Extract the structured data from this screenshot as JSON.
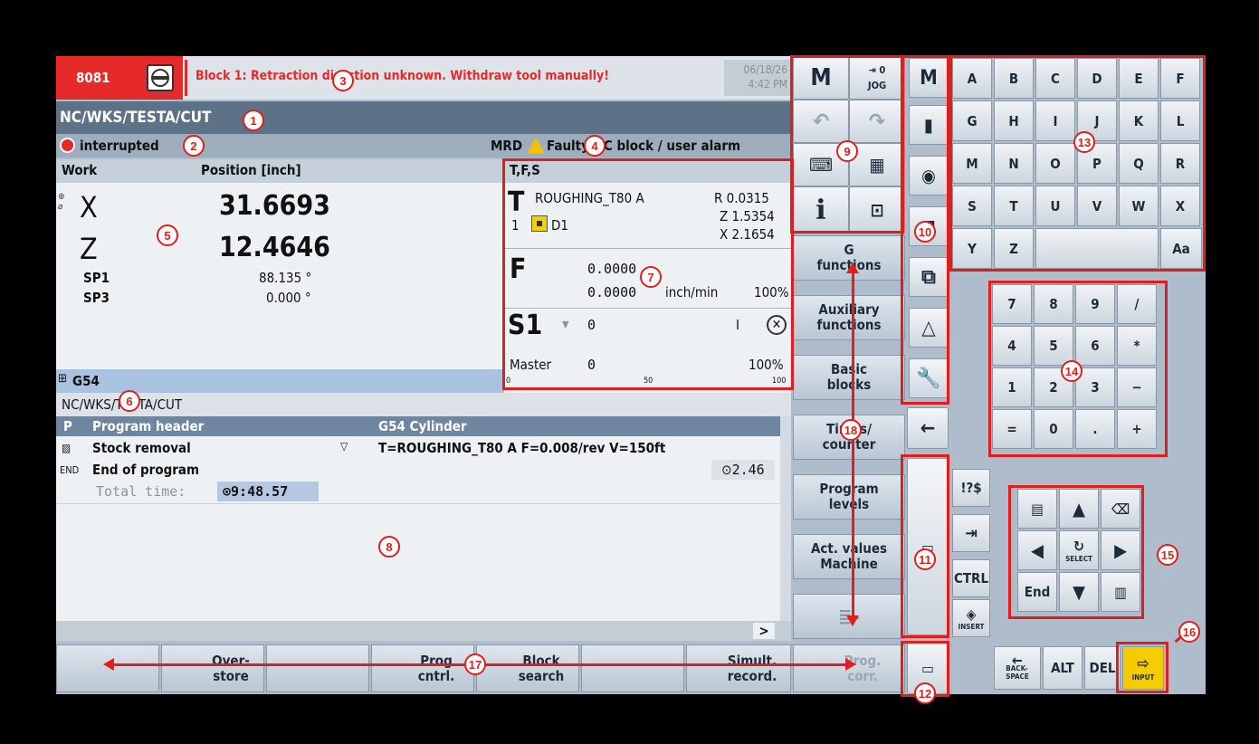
{
  "alarm": {
    "code": "8081",
    "message": "Block 1: Retraction direction unknown. Withdraw tool manually!",
    "date": "06/18/26",
    "time": "4:42 PM"
  },
  "path": "NC/WKS/TESTA/CUT",
  "status": {
    "state": "interrupted",
    "mode": "MRD",
    "warning": "Faulty NC block / user alarm"
  },
  "position": {
    "header_left": "Work",
    "header_right": "Position [inch]",
    "axes": [
      {
        "name": "X",
        "value": "31.6693"
      },
      {
        "name": "Z",
        "value": "12.4646"
      }
    ],
    "spindles": [
      {
        "name": "SP1",
        "value": "88.135 °"
      },
      {
        "name": "SP3",
        "value": "0.000 °"
      }
    ],
    "work_offset": "G54"
  },
  "tfs": {
    "title": "T,F,S",
    "tool": "ROUGHING_T80 A",
    "tool_num": "1",
    "edge": "D1",
    "r": "R 0.0315",
    "z": "Z 1.5354",
    "x": "X 2.1654",
    "feed1": "0.0000",
    "feed2": "0.0000",
    "feed_unit": "inch/min",
    "feed_pct": "100%",
    "spindle": "S1",
    "speed": "0",
    "spindle_dir": "I",
    "master_label": "Master",
    "master_val": "0",
    "master_pct": "100%",
    "scale": [
      "0",
      "50",
      "100"
    ]
  },
  "program": {
    "path": "NC/WKS/TESTA/CUT",
    "rows": [
      {
        "tag": "P",
        "name": "Program header",
        "param": "G54 Cylinder"
      },
      {
        "tag": "▨",
        "name": "Stock removal",
        "param": "T=ROUGHING_T80 A F=0.008/rev V=150ft"
      },
      {
        "tag": "END",
        "name": "End of program",
        "param": "2.46"
      }
    ],
    "total_label": "Total time:",
    "total_value": "9:48.57"
  },
  "softkeys_h": [
    "",
    "Over-\nstore",
    "",
    "Prog\ncntrl.",
    "Block\nsearch",
    "",
    "Simult.\nrecord."
  ],
  "softkeys_v": [
    "G\nfunctions",
    "Auxiliary\nfunctions",
    "Basic\nblocks",
    "Times/\ncounter",
    "Program\nlevels",
    "Act. values\nMachine",
    "",
    "Prog.\ncorr."
  ],
  "top_keys": {
    "jog": "JOG",
    "info": "i"
  },
  "alpha": [
    "A",
    "B",
    "C",
    "D",
    "E",
    "F",
    "G",
    "H",
    "I",
    "J",
    "K",
    "L",
    "M",
    "N",
    "O",
    "P",
    "Q",
    "R",
    "S",
    "T",
    "U",
    "V",
    "W",
    "X",
    "Y",
    "Z"
  ],
  "numpad": [
    "7",
    "8",
    "9",
    "/",
    "4",
    "5",
    "6",
    "*",
    "1",
    "2",
    "3",
    "−",
    "=",
    "0",
    ".",
    "+"
  ],
  "keys": {
    "special": "!?$",
    "ctrl": "CTRL",
    "insert": "INSERT",
    "backspace": "BACK-\nSPACE",
    "alt": "ALT",
    "del": "DEL",
    "input": "INPUT",
    "end": "End",
    "select": "SELECT",
    "case": "Aa"
  },
  "callouts": [
    "1",
    "2",
    "3",
    "4",
    "5",
    "6",
    "7",
    "8",
    "9",
    "10",
    "11",
    "12",
    "13",
    "14",
    "15",
    "16",
    "17",
    "18"
  ],
  "colors": {
    "alarm_red": "#e62a2a",
    "callout_red": "#e01e1e",
    "panel": "#aebccb"
  }
}
